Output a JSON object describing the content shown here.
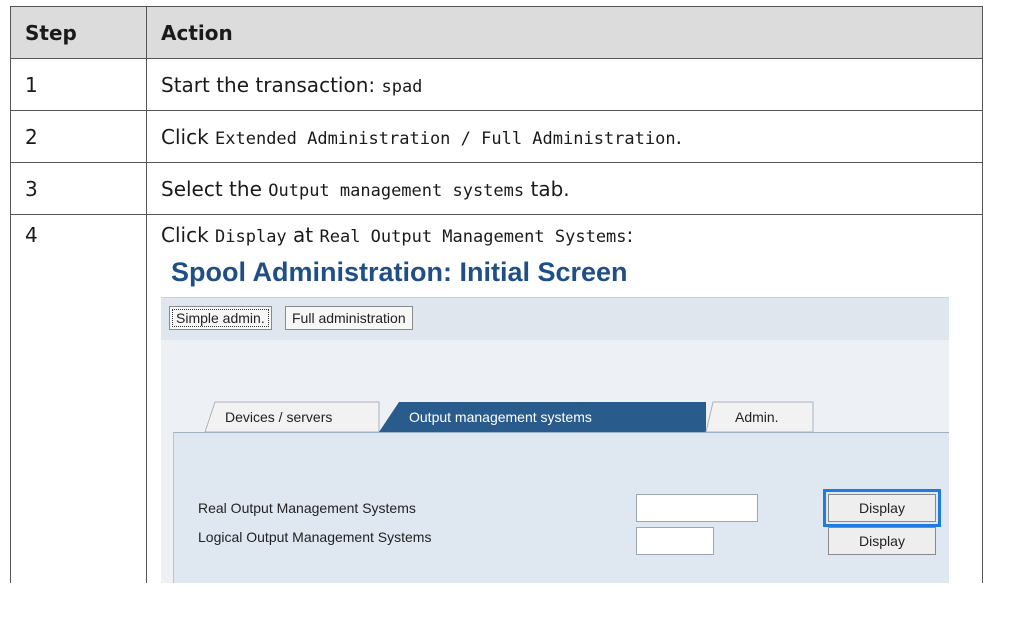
{
  "table": {
    "headers": {
      "step": "Step",
      "action": "Action"
    },
    "rows": [
      {
        "step": "1",
        "text_a": "Start the transaction: ",
        "code_a": "spad",
        "text_b": ""
      },
      {
        "step": "2",
        "text_a": "Click ",
        "code_a": "Extended Administration / Full Administration",
        "text_b": "."
      },
      {
        "step": "3",
        "text_a": "Select the ",
        "code_a": "Output management systems",
        "text_b": " tab."
      },
      {
        "step": "4",
        "text_a": "Click ",
        "code_a": "Display",
        "text_b": " at ",
        "code_b": "Real Output Management Systems",
        "text_c": ":"
      }
    ]
  },
  "sap": {
    "title": "Spool Administration: Initial Screen",
    "toolbar": {
      "simple_admin": "Simple admin.",
      "full_admin": "Full administration"
    },
    "tabs": [
      {
        "label": "Devices / servers",
        "active": false
      },
      {
        "label": "Output management systems",
        "active": true
      },
      {
        "label": "Admin.",
        "active": false
      }
    ],
    "rows": [
      {
        "label": "Real Output Management Systems",
        "input_value": "",
        "button": "Display"
      },
      {
        "label": "Logical Output Management Systems",
        "input_value": "",
        "button": "Display"
      }
    ],
    "colors": {
      "title": "#1f4f86",
      "active_tab": "#2a5b8d",
      "focus": "#1e7be0"
    }
  }
}
